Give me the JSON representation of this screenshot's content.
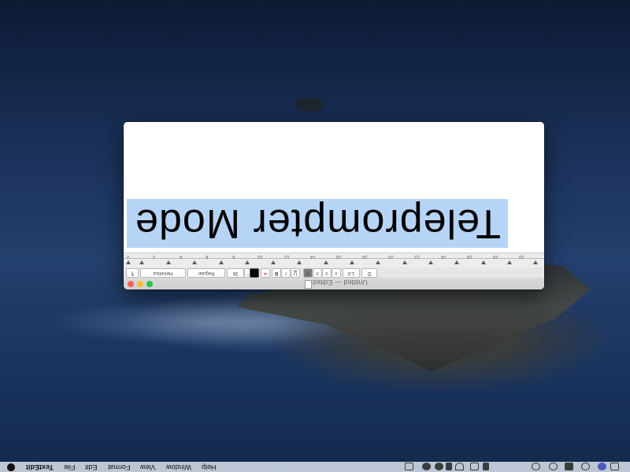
{
  "document": {
    "text": "Teleprompter Mode"
  },
  "window": {
    "title": "Untitled — Edited"
  },
  "ruler": {
    "labels": [
      "0",
      "2",
      "4",
      "6",
      "8",
      "10",
      "12",
      "14",
      "16",
      "18",
      "20",
      "22",
      "24",
      "26",
      "28",
      "30"
    ]
  },
  "toolbar": {
    "font_family": "Helvetica",
    "font_style": "Regular",
    "font_size": "36",
    "line_spacing": "1.0",
    "bold": "B",
    "italic": "I",
    "underline": "U",
    "list": "☰"
  },
  "menubar": {
    "app_name": "TextEdit",
    "items": [
      "File",
      "Edit",
      "Format",
      "View",
      "Window",
      "Help"
    ]
  },
  "status_icons": [
    "time-machine-icon",
    "location-icon",
    "apple-glyph-icon",
    "sync-icon",
    "wifi-icon",
    "airplay-icon",
    "volume-icon",
    "clock-icon",
    "help-icon",
    "user-icon",
    "search-icon",
    "siri-icon",
    "notification-center-icon"
  ]
}
